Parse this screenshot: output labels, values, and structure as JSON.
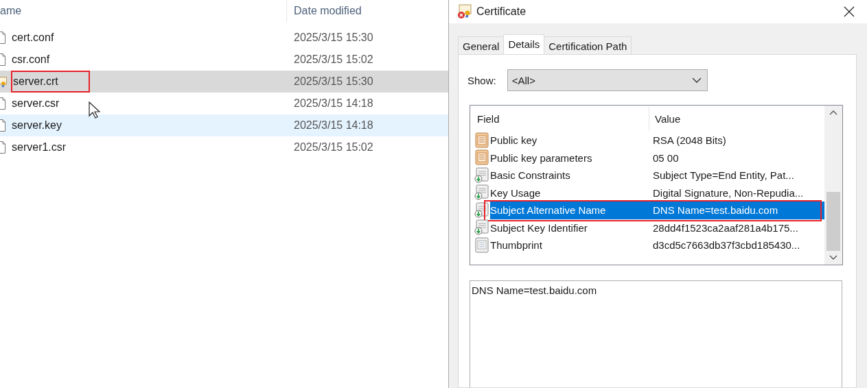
{
  "explorer": {
    "columns": [
      "ame",
      "Date modified"
    ],
    "files": [
      {
        "name": "cert.conf",
        "date": "2025/3/15 15:30",
        "kind": "document",
        "selected": false,
        "hovered": false,
        "annotated": false
      },
      {
        "name": "csr.conf",
        "date": "2025/3/15 15:02",
        "kind": "document",
        "selected": false,
        "hovered": false,
        "annotated": false
      },
      {
        "name": "server.crt",
        "date": "2025/3/15 15:30",
        "kind": "certificate",
        "selected": true,
        "hovered": false,
        "annotated": true
      },
      {
        "name": "server.csr",
        "date": "2025/3/15 14:18",
        "kind": "document",
        "selected": false,
        "hovered": false,
        "annotated": false
      },
      {
        "name": "server.key",
        "date": "2025/3/15 14:18",
        "kind": "document",
        "selected": false,
        "hovered": true,
        "annotated": false
      },
      {
        "name": "server1.csr",
        "date": "2025/3/15 15:02",
        "kind": "document",
        "selected": false,
        "hovered": false,
        "annotated": false
      }
    ]
  },
  "dialog": {
    "title": "Certificate",
    "tabs": [
      {
        "label": "General",
        "selected": false
      },
      {
        "label": "Details",
        "selected": true
      },
      {
        "label": "Certification Path",
        "selected": false
      }
    ],
    "show_label": "Show:",
    "show_value": "<All>",
    "columns": [
      "Field",
      "Value"
    ],
    "fields": [
      {
        "name": "Public key",
        "value": "RSA (2048 Bits)",
        "kind": "property",
        "selected": false,
        "annotated": false
      },
      {
        "name": "Public key parameters",
        "value": "05 00",
        "kind": "property",
        "selected": false,
        "annotated": false
      },
      {
        "name": "Basic Constraints",
        "value": "Subject Type=End Entity, Pat...",
        "kind": "extension",
        "selected": false,
        "annotated": false
      },
      {
        "name": "Key Usage",
        "value": "Digital Signature, Non-Repudia...",
        "kind": "extension",
        "selected": false,
        "annotated": false
      },
      {
        "name": "Subject Alternative Name",
        "value": "DNS Name=test.baidu.com",
        "kind": "extension",
        "selected": true,
        "annotated": true
      },
      {
        "name": "Subject Key Identifier",
        "value": "28dd4f1523ca2aaf281a4b175...",
        "kind": "extension",
        "selected": false,
        "annotated": false
      },
      {
        "name": "Thumbprint",
        "value": "d3cd5c7663db37f3cbd185430...",
        "kind": "plain",
        "selected": false,
        "annotated": false
      }
    ],
    "detail_text": "DNS Name=test.baidu.com"
  }
}
